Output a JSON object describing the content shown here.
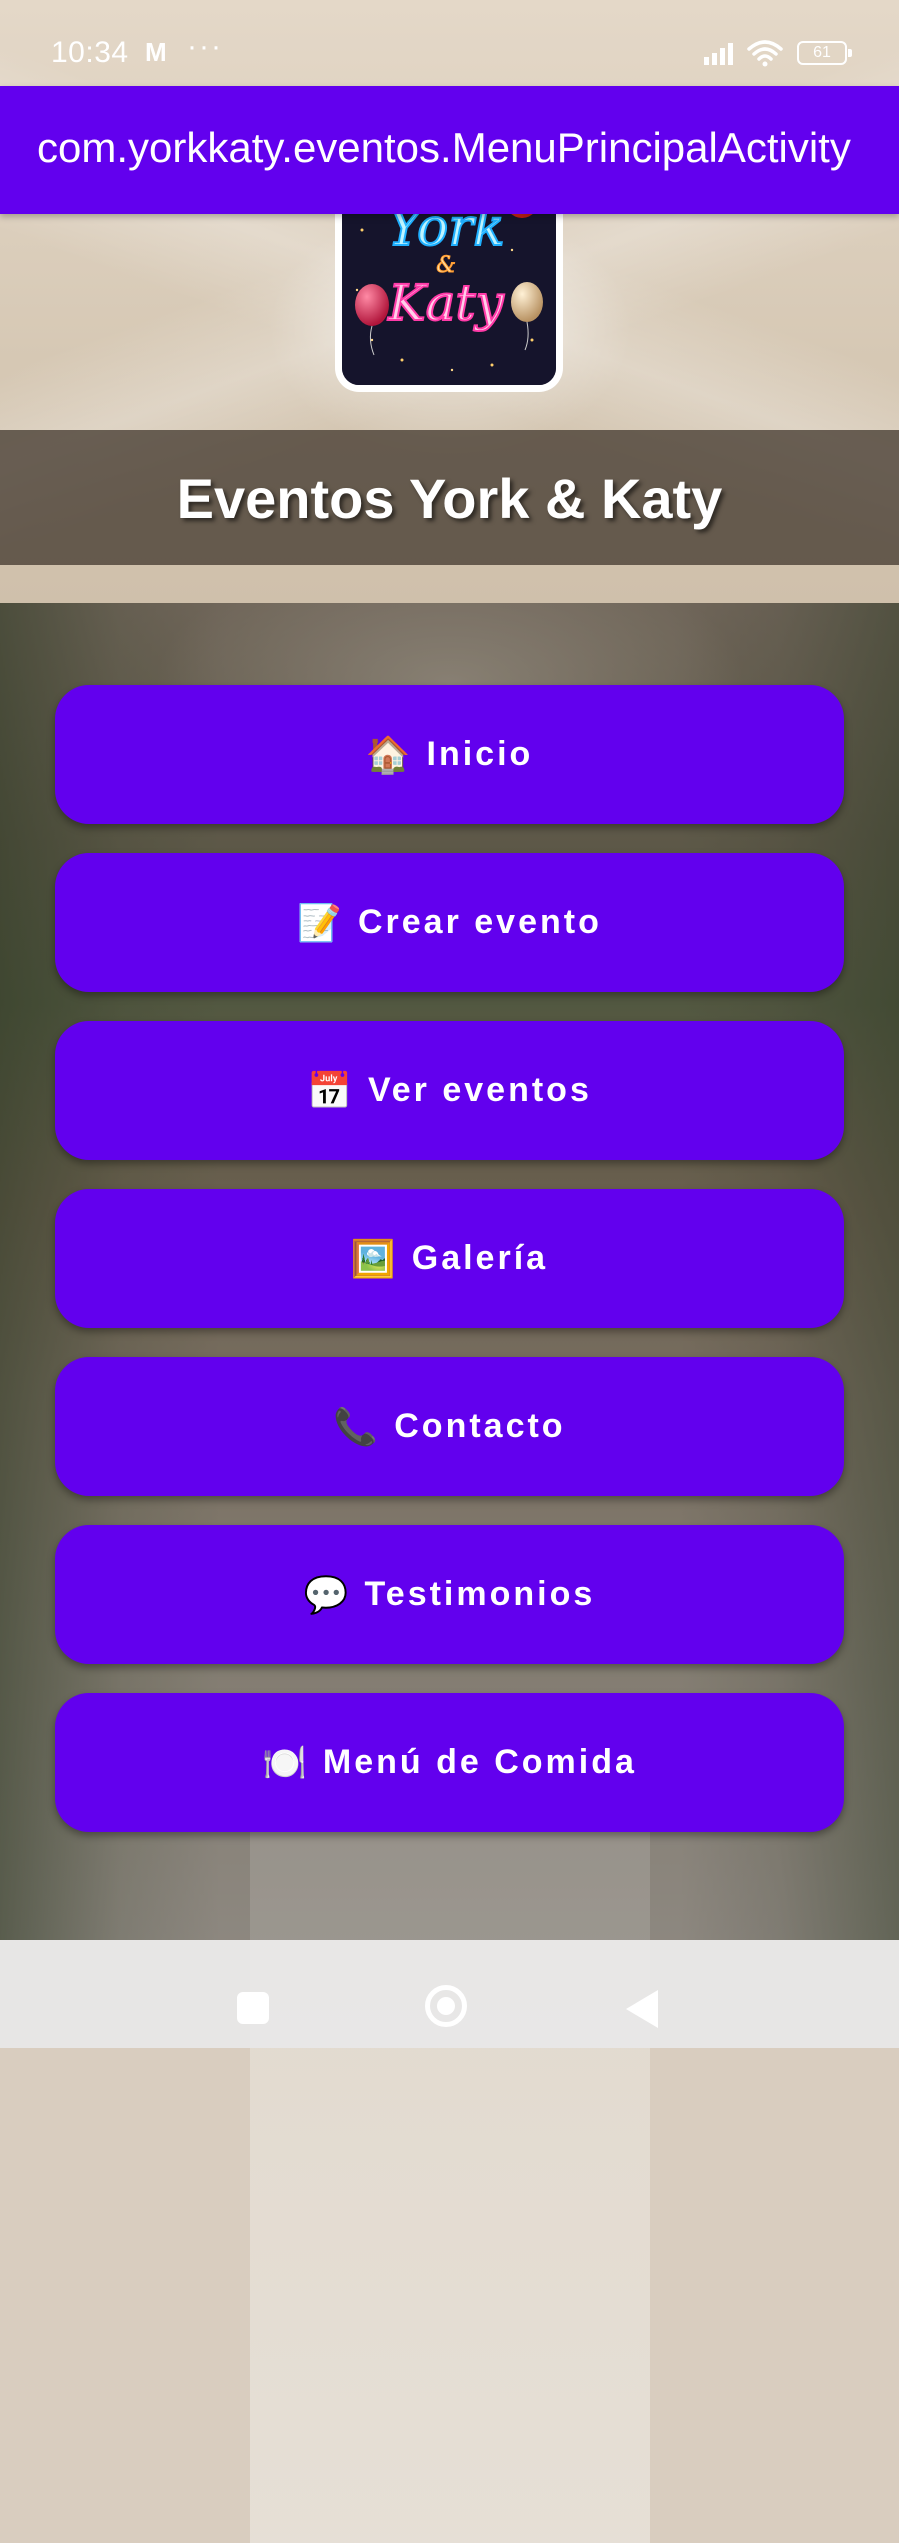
{
  "status_bar": {
    "time": "10:34",
    "notification_icons": [
      "gmail-icon",
      "more-dots-icon"
    ],
    "more_text": "···",
    "gmail_text": "M",
    "signal_bars": 4,
    "wifi_icon": "wifi-icon",
    "battery_level": "61"
  },
  "action_bar": {
    "title": "com.yorkkaty.eventos.MenuPrincipalActivity",
    "background_color": "#6200ee"
  },
  "logo": {
    "line1": "York",
    "line2": "&",
    "line3": "Katy"
  },
  "header": {
    "title": "Eventos York & Katy"
  },
  "menu": {
    "button_color": "#6200ee",
    "items": [
      {
        "icon": "🏠",
        "icon_name": "house-icon",
        "label": "Inicio"
      },
      {
        "icon": "📝",
        "icon_name": "memo-icon",
        "label": "Crear evento"
      },
      {
        "icon": "📅",
        "icon_name": "calendar-icon",
        "label": "Ver eventos"
      },
      {
        "icon": "🖼️",
        "icon_name": "framed-picture-icon",
        "label": "Galería"
      },
      {
        "icon": "📞",
        "icon_name": "telephone-icon",
        "label": "Contacto"
      },
      {
        "icon": "💬",
        "icon_name": "speech-bubble-icon",
        "label": "Testimonios"
      },
      {
        "icon": "🍽️",
        "icon_name": "plate-cutlery-icon",
        "label": "Menú de Comida"
      }
    ]
  },
  "nav_bar": {
    "buttons": [
      "recents-icon",
      "home-icon",
      "back-icon"
    ]
  }
}
